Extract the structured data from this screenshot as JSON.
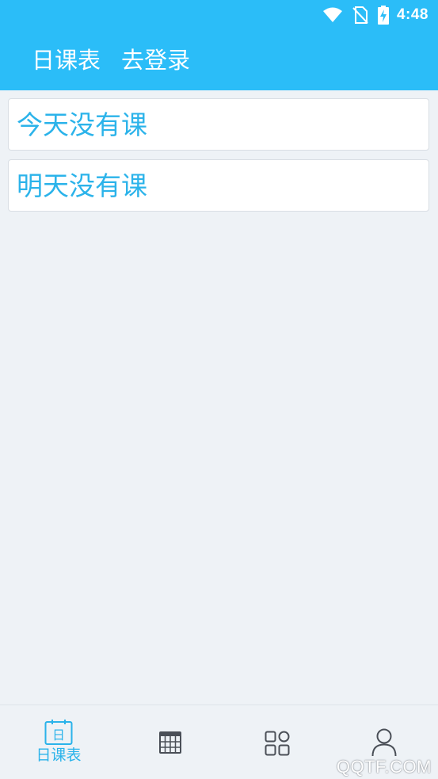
{
  "status_bar": {
    "time": "4:48",
    "icons": [
      "wifi-icon",
      "no-sim-icon",
      "battery-charging-icon"
    ]
  },
  "header": {
    "title": "日课表",
    "login_label": "去登录",
    "background_color": "#2bbdf8"
  },
  "schedule": {
    "items": [
      {
        "label": "今天没有课"
      },
      {
        "label": "明天没有课"
      }
    ],
    "accent_color": "#2bb3ea"
  },
  "bottom_nav": {
    "items": [
      {
        "icon": "calendar-day-icon",
        "icon_text": "日",
        "label": "日课表",
        "active": true
      },
      {
        "icon": "table-grid-icon",
        "label": ""
      },
      {
        "icon": "apps-grid-icon",
        "label": ""
      },
      {
        "icon": "user-icon",
        "label": ""
      }
    ]
  },
  "watermark": "QQTF.COM"
}
